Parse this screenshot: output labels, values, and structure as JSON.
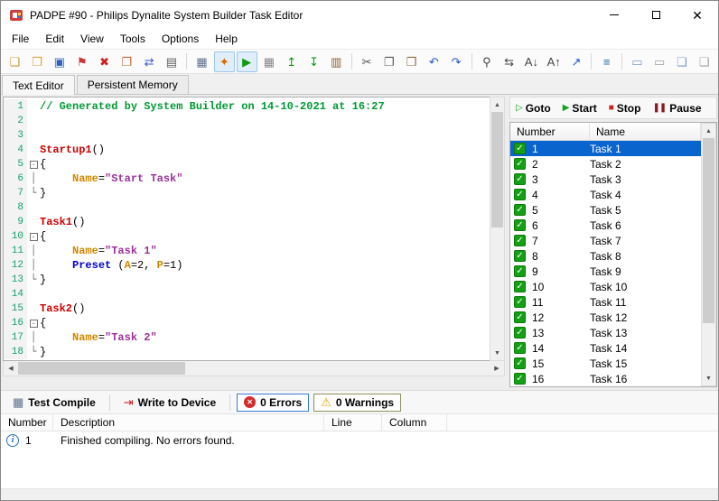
{
  "window": {
    "title": "PADPE #90 - Philips Dynalite System Builder Task Editor",
    "controls": {
      "close": "✕"
    }
  },
  "menu": {
    "items": [
      "File",
      "Edit",
      "View",
      "Tools",
      "Options",
      "Help"
    ]
  },
  "toolbar": {
    "items": [
      {
        "name": "new-file",
        "glyph": "❏",
        "color": "#c79a3b"
      },
      {
        "name": "open-folder",
        "glyph": "❒",
        "color": "#d9a23b"
      },
      {
        "name": "save",
        "glyph": "▣",
        "color": "#2f5fbf"
      },
      {
        "name": "edit-document",
        "glyph": "⚑",
        "color": "#cc3333"
      },
      {
        "name": "delete",
        "glyph": "✖",
        "color": "#cc2222"
      },
      {
        "name": "copy-page",
        "glyph": "❐",
        "color": "#cc6633"
      },
      {
        "name": "transfer",
        "glyph": "⇄",
        "color": "#3355cc"
      },
      {
        "name": "print",
        "glyph": "▤",
        "color": "#606060"
      },
      {
        "sep": true
      },
      {
        "name": "task-grid",
        "glyph": "▦",
        "color": "#607090"
      },
      {
        "name": "compile",
        "glyph": "✦",
        "color": "#dd6600",
        "hl": true
      },
      {
        "name": "run",
        "glyph": "▶",
        "color": "#119911",
        "hl": true
      },
      {
        "name": "memory-grid",
        "glyph": "▦",
        "color": "#888888"
      },
      {
        "name": "upload-device",
        "glyph": "↥",
        "color": "#119911"
      },
      {
        "name": "download-device",
        "glyph": "↧",
        "color": "#119911"
      },
      {
        "name": "library",
        "glyph": "▥",
        "color": "#8a5a2a"
      },
      {
        "sep": true
      },
      {
        "name": "cut",
        "glyph": "✂",
        "color": "#555555"
      },
      {
        "name": "copy",
        "glyph": "❐",
        "color": "#555555"
      },
      {
        "name": "paste",
        "glyph": "❒",
        "color": "#8a6a3a"
      },
      {
        "name": "undo",
        "glyph": "↶",
        "color": "#2255cc"
      },
      {
        "name": "redo",
        "glyph": "↷",
        "color": "#2255cc"
      },
      {
        "sep": true
      },
      {
        "name": "find",
        "glyph": "⚲",
        "color": "#444444"
      },
      {
        "name": "replace",
        "glyph": "⇆",
        "color": "#444444"
      },
      {
        "name": "find-next",
        "glyph": "A↓",
        "color": "#444444"
      },
      {
        "name": "find-previous",
        "glyph": "A↑",
        "color": "#444444"
      },
      {
        "name": "goto-line",
        "glyph": "↗",
        "color": "#2255cc"
      },
      {
        "sep": true
      },
      {
        "name": "line-list",
        "glyph": "≡",
        "color": "#2e6da4"
      },
      {
        "sep": true
      },
      {
        "name": "comment",
        "glyph": "▭",
        "color": "#7a9cc6"
      },
      {
        "name": "uncomment",
        "glyph": "▭",
        "color": "#a0a0a0"
      },
      {
        "name": "note",
        "glyph": "❑",
        "color": "#7a9cc6"
      },
      {
        "name": "note-off",
        "glyph": "❑",
        "color": "#a0a0a0"
      }
    ]
  },
  "tabs": {
    "items": [
      {
        "label": "Text Editor",
        "active": true
      },
      {
        "label": "Persistent Memory",
        "active": false
      }
    ]
  },
  "scrollbar": {
    "up": "▲",
    "down": "▼",
    "left": "◀",
    "right": "▶"
  },
  "editor": {
    "colors": {
      "com": "#009933",
      "fn": "#cc0000",
      "prop": "#cc8800",
      "str": "#993399",
      "kw": "#0000cc",
      "pl": "#000000"
    },
    "lines": [
      {
        "n": 1,
        "fold": "",
        "seg": [
          [
            "// Generated by System Builder on 14-10-2021 at 16:27",
            "com"
          ]
        ]
      },
      {
        "n": 2,
        "fold": "",
        "seg": []
      },
      {
        "n": 3,
        "fold": "",
        "seg": []
      },
      {
        "n": 4,
        "fold": "",
        "seg": [
          [
            "Startup1",
            "fn"
          ],
          [
            "()",
            "pl"
          ]
        ]
      },
      {
        "n": 5,
        "fold": "start",
        "seg": [
          [
            "{",
            "pl"
          ]
        ]
      },
      {
        "n": 6,
        "fold": "mid",
        "seg": [
          [
            "     ",
            "pl"
          ],
          [
            "Name",
            "prop"
          ],
          [
            "=",
            "pl"
          ],
          [
            "\"Start Task\"",
            "str"
          ]
        ]
      },
      {
        "n": 7,
        "fold": "end",
        "seg": [
          [
            "}",
            "pl"
          ]
        ]
      },
      {
        "n": 8,
        "fold": "",
        "seg": []
      },
      {
        "n": 9,
        "fold": "",
        "seg": [
          [
            "Task1",
            "fn"
          ],
          [
            "()",
            "pl"
          ]
        ]
      },
      {
        "n": 10,
        "fold": "start",
        "seg": [
          [
            "{",
            "pl"
          ]
        ]
      },
      {
        "n": 11,
        "fold": "mid",
        "seg": [
          [
            "     ",
            "pl"
          ],
          [
            "Name",
            "prop"
          ],
          [
            "=",
            "pl"
          ],
          [
            "\"Task 1\"",
            "str"
          ]
        ]
      },
      {
        "n": 12,
        "fold": "mid",
        "seg": [
          [
            "     ",
            "pl"
          ],
          [
            "Preset",
            "kw"
          ],
          [
            " (",
            "pl"
          ],
          [
            "A",
            "prop"
          ],
          [
            "=2, ",
            "pl"
          ],
          [
            "P",
            "prop"
          ],
          [
            "=1)",
            "pl"
          ]
        ]
      },
      {
        "n": 13,
        "fold": "end",
        "seg": [
          [
            "}",
            "pl"
          ]
        ]
      },
      {
        "n": 14,
        "fold": "",
        "seg": []
      },
      {
        "n": 15,
        "fold": "",
        "seg": [
          [
            "Task2",
            "fn"
          ],
          [
            "()",
            "pl"
          ]
        ]
      },
      {
        "n": 16,
        "fold": "start",
        "seg": [
          [
            "{",
            "pl"
          ]
        ]
      },
      {
        "n": 17,
        "fold": "mid",
        "seg": [
          [
            "     ",
            "pl"
          ],
          [
            "Name",
            "prop"
          ],
          [
            "=",
            "pl"
          ],
          [
            "\"Task 2\"",
            "str"
          ]
        ]
      },
      {
        "n": 18,
        "fold": "end",
        "seg": [
          [
            "}",
            "pl"
          ]
        ]
      }
    ]
  },
  "task_panel": {
    "check_glyph": "✓",
    "buttons": [
      {
        "label": "Goto",
        "icon": "goto-arrow-icon",
        "glyph": "▷",
        "color": "#18a018"
      },
      {
        "label": "Start",
        "icon": "start-icon",
        "glyph": "▶",
        "color": "#18a018"
      },
      {
        "label": "Stop",
        "icon": "stop-icon",
        "glyph": "■",
        "color": "#cc2222"
      },
      {
        "label": "Pause",
        "icon": "pause-icon",
        "glyph": "❚❚",
        "color": "#8a1a1a"
      }
    ],
    "columns": [
      "Number",
      "Name"
    ],
    "rows": [
      {
        "number": "1",
        "name": "Task 1",
        "selected": true
      },
      {
        "number": "2",
        "name": "Task 2",
        "selected": false
      },
      {
        "number": "3",
        "name": "Task 3",
        "selected": false
      },
      {
        "number": "4",
        "name": "Task 4",
        "selected": false
      },
      {
        "number": "5",
        "name": "Task 5",
        "selected": false
      },
      {
        "number": "6",
        "name": "Task 6",
        "selected": false
      },
      {
        "number": "7",
        "name": "Task 7",
        "selected": false
      },
      {
        "number": "8",
        "name": "Task 8",
        "selected": false
      },
      {
        "number": "9",
        "name": "Task 9",
        "selected": false
      },
      {
        "number": "10",
        "name": "Task 10",
        "selected": false
      },
      {
        "number": "11",
        "name": "Task 11",
        "selected": false
      },
      {
        "number": "12",
        "name": "Task 12",
        "selected": false
      },
      {
        "number": "13",
        "name": "Task 13",
        "selected": false
      },
      {
        "number": "14",
        "name": "Task 14",
        "selected": false
      },
      {
        "number": "15",
        "name": "Task 15",
        "selected": false
      },
      {
        "number": "16",
        "name": "Task 16",
        "selected": false
      }
    ]
  },
  "compile_bar": {
    "items": [
      {
        "label": "Test Compile",
        "icon": "test-compile-icon",
        "glyph": "▦",
        "color": "#607090"
      },
      {
        "sep": true
      },
      {
        "label": "Write to Device",
        "icon": "write-device-icon",
        "glyph": "⇥",
        "color": "#cc2222"
      },
      {
        "sep": true
      },
      {
        "label": "0 Errors",
        "icon": "error-icon",
        "glyph": "✕",
        "icon_class": "err-ic",
        "style": "outlined-blue"
      },
      {
        "label": "0 Warnings",
        "icon": "warning-icon",
        "glyph": "⚠",
        "color": "#e0a400",
        "style": "outlined"
      }
    ]
  },
  "results": {
    "columns": [
      "Number",
      "Description",
      "Line",
      "Column"
    ],
    "rows": [
      {
        "number": "1",
        "description": "Finished compiling. No errors found."
      }
    ]
  }
}
